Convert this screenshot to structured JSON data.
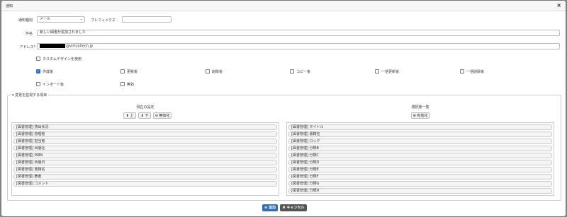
{
  "dialog": {
    "title": "通知",
    "close_icon": "close-icon"
  },
  "form": {
    "notify_type_label": "通知種別",
    "notify_type_value": "メール",
    "prefix_label": "プレフィックス",
    "prefix_value": "",
    "subject_label": "件名",
    "subject_value": "新しい図書が追加されました",
    "address_label": "アドレス",
    "address_required_mark": "*",
    "address_value_suffix": "@virtualtech.jp",
    "custom_design_label": "カスタムデザインを使用",
    "triggers": [
      {
        "label": "作成後",
        "checked": true
      },
      {
        "label": "更新後",
        "checked": false
      },
      {
        "label": "削除後",
        "checked": false
      },
      {
        "label": "コピー後",
        "checked": false
      },
      {
        "label": "一括更新後",
        "checked": false
      },
      {
        "label": "一括削除後",
        "checked": false
      },
      {
        "label": "インポート後",
        "checked": false
      },
      {
        "label": "無効",
        "checked": false
      }
    ]
  },
  "monitor": {
    "legend": "変更を監視する項目",
    "current_title": "現在の設定",
    "up_label": "上",
    "down_label": "下",
    "disable_label": "無効化",
    "available_title": "選択肢一覧",
    "enable_label": "有効化",
    "current_items": [
      "[図書管理] 貸出状況",
      "[図書管理] 管理者",
      "[図書管理] 担当者",
      "[図書管理] 出版社",
      "[図書管理] ISBN",
      "[図書管理] 出版日",
      "[図書管理] 書籍名",
      "[図書管理] 著者",
      "[図書管理] コメント"
    ],
    "available_items": [
      "[図書管理] タイトル",
      "[図書管理] 書籍名",
      "[図書管理] ロック",
      "[図書管理] 分類B",
      "[図書管理] 分類C",
      "[図書管理] 分類D",
      "[図書管理] 分類E",
      "[図書管理] 分類F",
      "[図書管理] 分類G",
      "[図書管理] 分類H"
    ]
  },
  "footer": {
    "add_label": "追加",
    "cancel_label": "キャンセル"
  },
  "colors": {
    "primary": "#2f6db5",
    "dark": "#555555",
    "checkbox": "#2d6fd6"
  }
}
